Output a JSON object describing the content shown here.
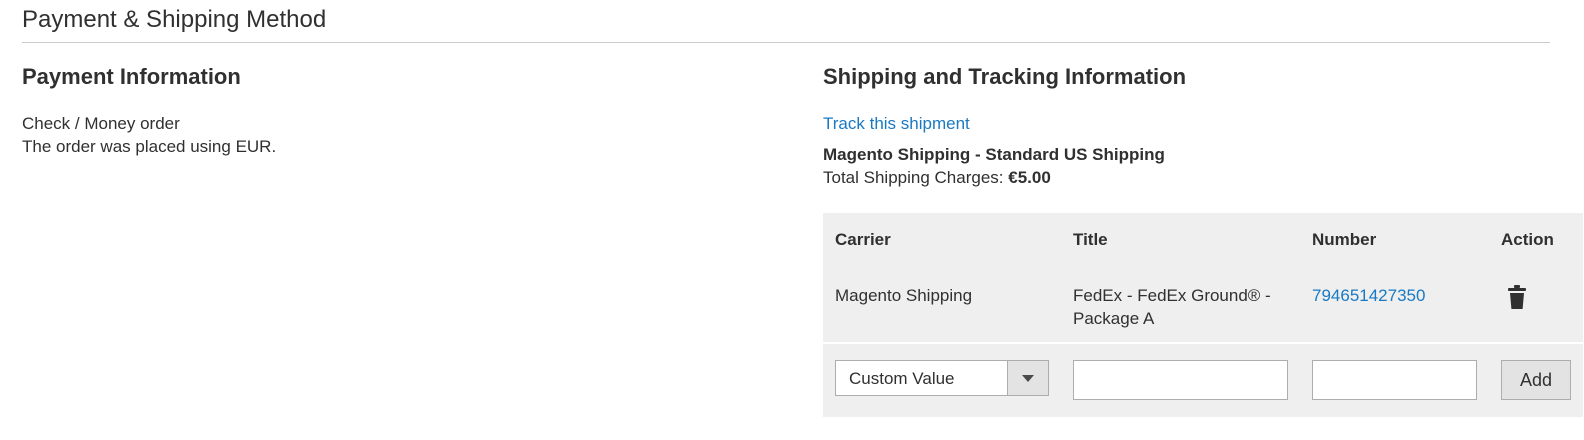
{
  "section": {
    "title": "Payment & Shipping Method"
  },
  "payment": {
    "title": "Payment Information",
    "method": "Check / Money order",
    "currency_note": "The order was placed using EUR."
  },
  "shipping": {
    "title": "Shipping and Tracking Information",
    "track_link": "Track this shipment",
    "method_name": "Magento Shipping - Standard US Shipping",
    "charges_label": "Total Shipping Charges: ",
    "charges_value": "€5.00"
  },
  "tracking_table": {
    "headers": {
      "carrier": "Carrier",
      "title": "Title",
      "number": "Number",
      "action": "Action"
    },
    "rows": [
      {
        "carrier": "Magento Shipping",
        "title": "FedEx - FedEx Ground® - Package A",
        "number": "794651427350",
        "action_icon": "trash-icon"
      }
    ],
    "new_row": {
      "carrier_select_value": "Custom Value",
      "title_value": "",
      "number_value": "",
      "add_label": "Add"
    }
  },
  "colors": {
    "link": "#1979c3",
    "text": "#303030",
    "table_bg": "#efefef",
    "divider": "#cccccc"
  }
}
